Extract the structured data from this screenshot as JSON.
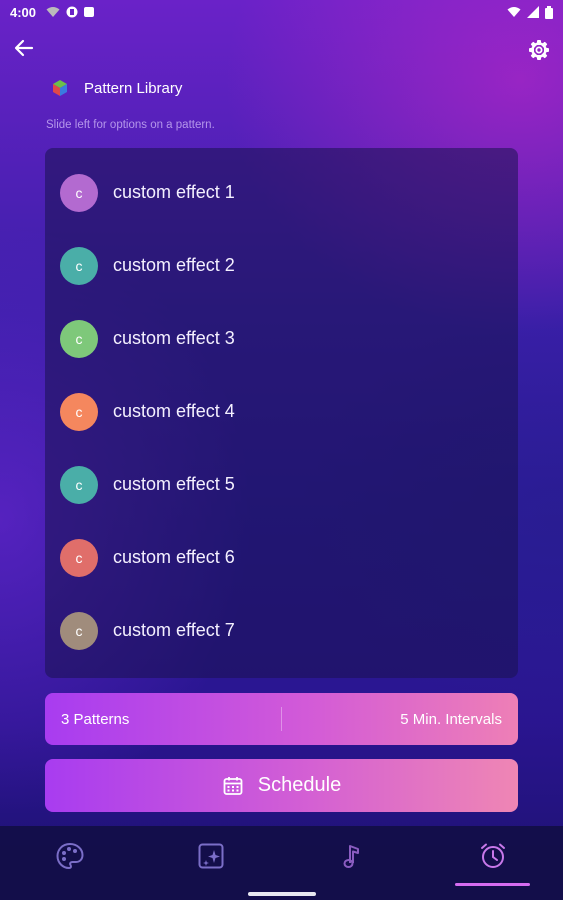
{
  "status_bar": {
    "time": "4:00"
  },
  "header": {
    "title": "Pattern Library",
    "hint": "Slide left for options on a pattern."
  },
  "patterns": [
    {
      "initial": "c",
      "name": "custom effect 1",
      "color": "#b36ad0"
    },
    {
      "initial": "c",
      "name": "custom effect 2",
      "color": "#4aaea8"
    },
    {
      "initial": "c",
      "name": "custom effect 3",
      "color": "#7ec87a"
    },
    {
      "initial": "c",
      "name": "custom effect 4",
      "color": "#f5875e"
    },
    {
      "initial": "c",
      "name": "custom effect 5",
      "color": "#4aaea8"
    },
    {
      "initial": "c",
      "name": "custom effect 6",
      "color": "#e06e6a"
    },
    {
      "initial": "c",
      "name": "custom effect 7",
      "color": "#a08c7c"
    }
  ],
  "summary": {
    "patterns_label": "3 Patterns",
    "interval_label": "5 Min. Intervals"
  },
  "schedule": {
    "label": "Schedule"
  },
  "bottom_nav": {
    "tabs": [
      {
        "icon": "palette-icon"
      },
      {
        "icon": "sparkle-effects-icon"
      },
      {
        "icon": "music-note-icon"
      },
      {
        "icon": "alarm-clock-icon",
        "active": true
      }
    ]
  }
}
